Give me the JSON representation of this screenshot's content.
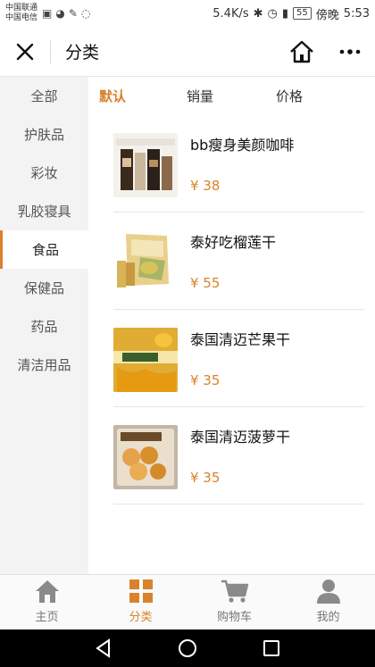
{
  "status": {
    "carrier1": "中国联通",
    "carrier2": "中国电信",
    "speed": "5.4K/s",
    "battery": "55",
    "carrier_right": "傍晚",
    "time": "5:53"
  },
  "header": {
    "title": "分类"
  },
  "sidebar": {
    "items": [
      {
        "label": "全部"
      },
      {
        "label": "护肤品"
      },
      {
        "label": "彩妆"
      },
      {
        "label": "乳胶寝具"
      },
      {
        "label": "食品"
      },
      {
        "label": "保健品"
      },
      {
        "label": "药品"
      },
      {
        "label": "清洁用品"
      }
    ],
    "active_index": 4
  },
  "sort": {
    "options": [
      {
        "label": "默认"
      },
      {
        "label": "销量"
      },
      {
        "label": "价格"
      }
    ],
    "active_index": 0
  },
  "products": [
    {
      "name": "bb瘦身美颜咖啡",
      "price": "¥ 38"
    },
    {
      "name": "泰好吃榴莲干",
      "price": "¥ 55"
    },
    {
      "name": "泰国清迈芒果干",
      "price": "¥ 35"
    },
    {
      "name": "泰国清迈菠萝干",
      "price": "¥ 35"
    }
  ],
  "bottom_nav": [
    {
      "label": "主页",
      "icon": "home-icon"
    },
    {
      "label": "分类",
      "icon": "grid-icon"
    },
    {
      "label": "购物车",
      "icon": "cart-icon"
    },
    {
      "label": "我的",
      "icon": "person-icon"
    }
  ],
  "bottom_nav_active": 1,
  "colors": {
    "accent": "#d9822b",
    "sidebar_bg": "#f3f3f3"
  }
}
